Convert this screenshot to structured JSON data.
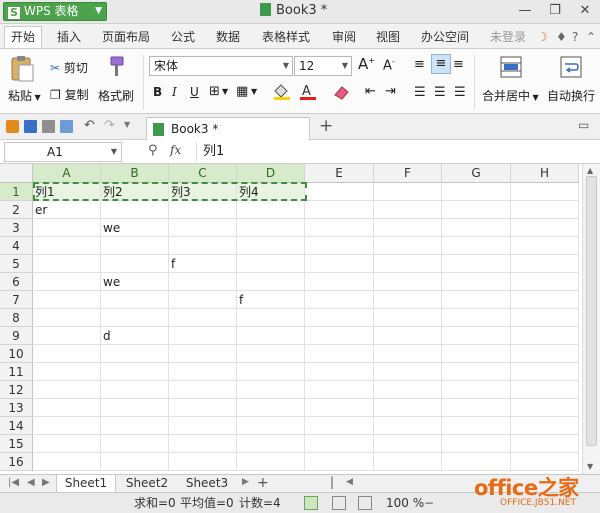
{
  "titlebar": {
    "app_name": "WPS 表格",
    "doc_title": "Book3 *"
  },
  "ribbon_tabs": [
    "开始",
    "插入",
    "页面布局",
    "公式",
    "数据",
    "表格样式",
    "审阅",
    "视图",
    "办公空间"
  ],
  "account": {
    "login_label": "未登录"
  },
  "clipboard": {
    "cut_label": "剪切",
    "copy_label": "复制",
    "paste_label": "粘贴",
    "format_painter_label": "格式刷"
  },
  "font": {
    "family": "宋体",
    "size": "12",
    "bold": "B",
    "italic": "I",
    "underline": "U"
  },
  "alignment": {
    "merge_center_label": "合并居中",
    "wrap_label": "自动换行"
  },
  "workbook_tab": {
    "label": "Book3 *"
  },
  "formula_bar": {
    "name_box": "A1",
    "fx_label": "fx",
    "value": "列1"
  },
  "grid": {
    "columns": [
      "A",
      "B",
      "C",
      "D",
      "E",
      "F",
      "G",
      "H"
    ],
    "rows": [
      "1",
      "2",
      "3",
      "4",
      "5",
      "6",
      "7",
      "8",
      "9",
      "10",
      "11",
      "12",
      "13",
      "14",
      "15",
      "16"
    ],
    "cells": [
      {
        "ref": "A1",
        "value": "列1"
      },
      {
        "ref": "B1",
        "value": "列2"
      },
      {
        "ref": "C1",
        "value": "列3"
      },
      {
        "ref": "D1",
        "value": "列4"
      },
      {
        "ref": "A2",
        "value": "er"
      },
      {
        "ref": "B3",
        "value": "we"
      },
      {
        "ref": "C5",
        "value": "f"
      },
      {
        "ref": "B6",
        "value": "we"
      },
      {
        "ref": "D7",
        "value": "f"
      },
      {
        "ref": "B9",
        "value": "d"
      }
    ],
    "selection": "A1:D1"
  },
  "sheet_tabs": [
    "Sheet1",
    "Sheet2",
    "Sheet3"
  ],
  "active_sheet": "Sheet1",
  "status": {
    "sum": "求和=0",
    "average": "平均值=0",
    "count": "计数=4",
    "zoom": "100 %"
  },
  "watermark": {
    "main": "office之家",
    "sub": "OFFICE.JB51.NET"
  },
  "colors": {
    "accent_green": "#4da34d",
    "selection_green": "#d7eacc",
    "watermark_orange": "#e96a12"
  }
}
